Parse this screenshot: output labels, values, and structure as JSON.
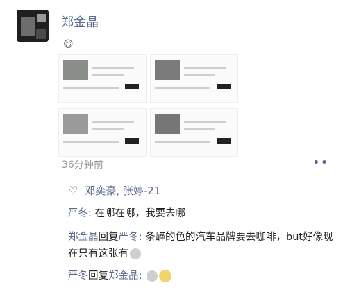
{
  "post": {
    "author": "郑金晶",
    "body_emoji": "😄",
    "time": "36分钟前",
    "more_label": "••",
    "likes_text": "邓奕豪, 张婷-21",
    "thumbnails": [
      "image-1",
      "image-2",
      "image-3",
      "image-4"
    ]
  },
  "comments": [
    {
      "name": "严冬",
      "sep": ": ",
      "text": "在哪在哪，我要去哪"
    },
    {
      "name": "郑金晶",
      "reply_word": "回复",
      "reply_to": "严冬",
      "sep": ": ",
      "text": "条醉的色的汽车品牌要去咖啡，but好像现在只有这张有"
    },
    {
      "name": "严冬",
      "reply_word": "回复",
      "reply_to": "郑金晶",
      "sep": ": ",
      "text": ""
    }
  ],
  "colors": {
    "link": "#5b6b8c",
    "time": "#999999"
  }
}
